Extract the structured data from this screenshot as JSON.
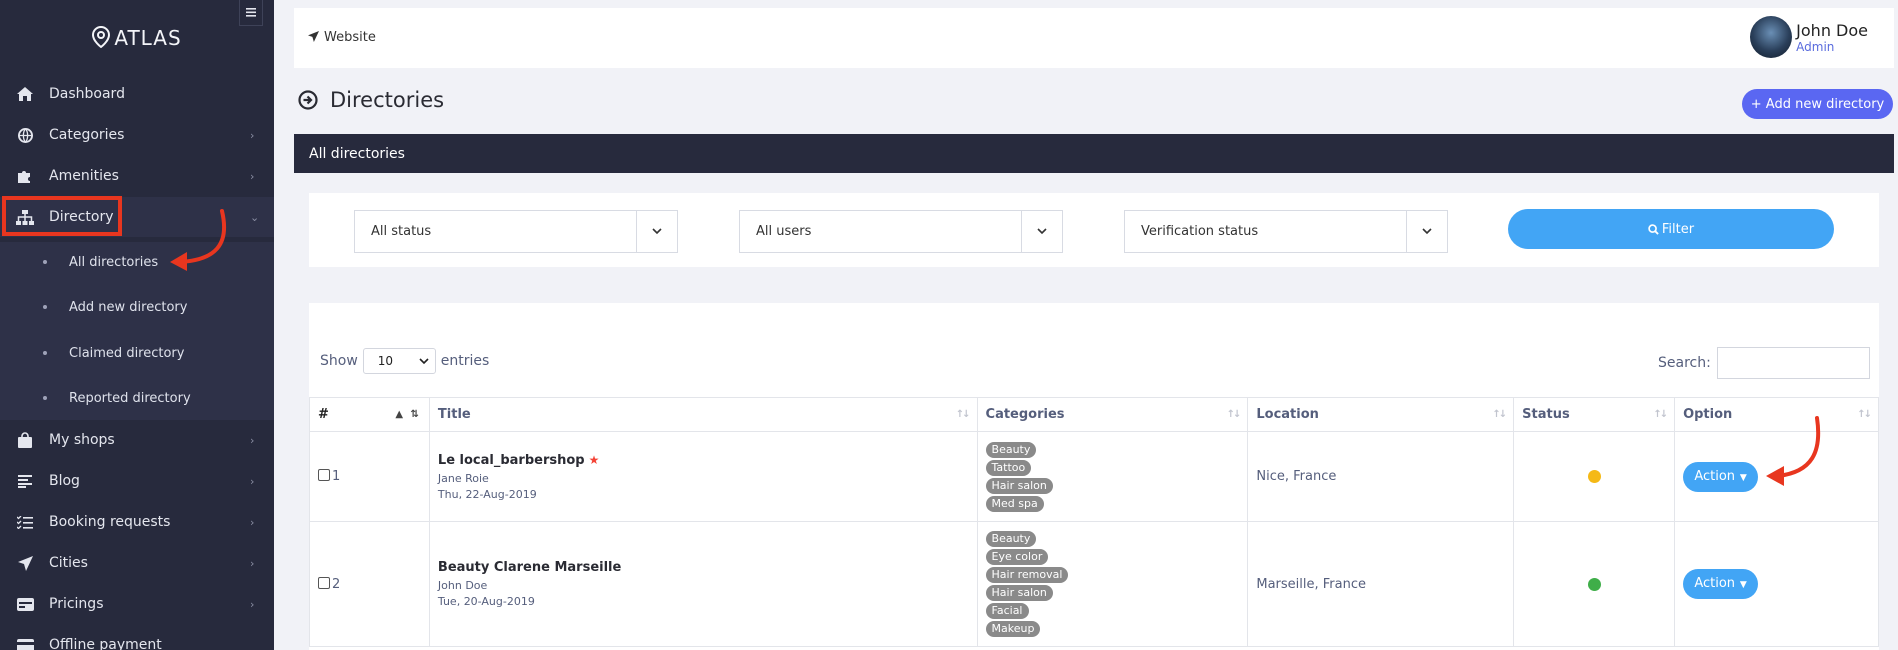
{
  "app": {
    "brand": "ATLAS"
  },
  "sidebar": {
    "items": [
      {
        "label": "Dashboard",
        "icon": "home-icon"
      },
      {
        "label": "Categories",
        "icon": "globe-icon"
      },
      {
        "label": "Amenities",
        "icon": "puzzle-icon"
      },
      {
        "label": "Directory",
        "icon": "sitemap-icon"
      },
      {
        "label": "My shops",
        "icon": "shopping-bag-icon"
      },
      {
        "label": "Blog",
        "icon": "blog-icon"
      },
      {
        "label": "Booking requests",
        "icon": "list-check-icon"
      },
      {
        "label": "Cities",
        "icon": "location-arrow-icon"
      },
      {
        "label": "Pricings",
        "icon": "pricing-icon"
      },
      {
        "label": "Offline payment",
        "icon": "payment-icon"
      }
    ],
    "submenu": [
      {
        "label": "All directories"
      },
      {
        "label": "Add new directory"
      },
      {
        "label": "Claimed directory"
      },
      {
        "label": "Reported directory"
      }
    ]
  },
  "topbar": {
    "website_label": "Website",
    "user_name": "John Doe",
    "user_role": "Admin"
  },
  "page": {
    "title": "Directories",
    "add_button": "+ Add new directory",
    "card_title": "All directories"
  },
  "filters": {
    "status": "All status",
    "users": "All users",
    "verification": "Verification status",
    "filter_button": "Filter"
  },
  "table_controls": {
    "show_label": "Show",
    "entries_value": "10",
    "entries_label": "entries",
    "search_label": "Search:"
  },
  "table": {
    "headers": [
      "#",
      "Title",
      "Categories",
      "Location",
      "Status",
      "Option"
    ],
    "rows": [
      {
        "num": "1",
        "title": "Le local_barbershop",
        "featured": true,
        "author": "Jane Roie",
        "date": "Thu, 22-Aug-2019",
        "categories": [
          "Beauty",
          "Tattoo",
          "Hair salon",
          "Med spa"
        ],
        "location": "Nice, France",
        "status_color": "#f5b916",
        "action": "Action"
      },
      {
        "num": "2",
        "title": "Beauty Clarene Marseille",
        "featured": false,
        "author": "John Doe",
        "date": "Tue, 20-Aug-2019",
        "categories": [
          "Beauty",
          "Eye color",
          "Hair removal",
          "Hair salon",
          "Facial",
          "Makeup"
        ],
        "location": "Marseille, France",
        "status_color": "#3fae49",
        "action": "Action"
      }
    ]
  },
  "colors": {
    "sidebar": "#272a3d",
    "accent": "#42a5f5",
    "primary": "#5a67f2",
    "annotation": "#e8361f"
  }
}
